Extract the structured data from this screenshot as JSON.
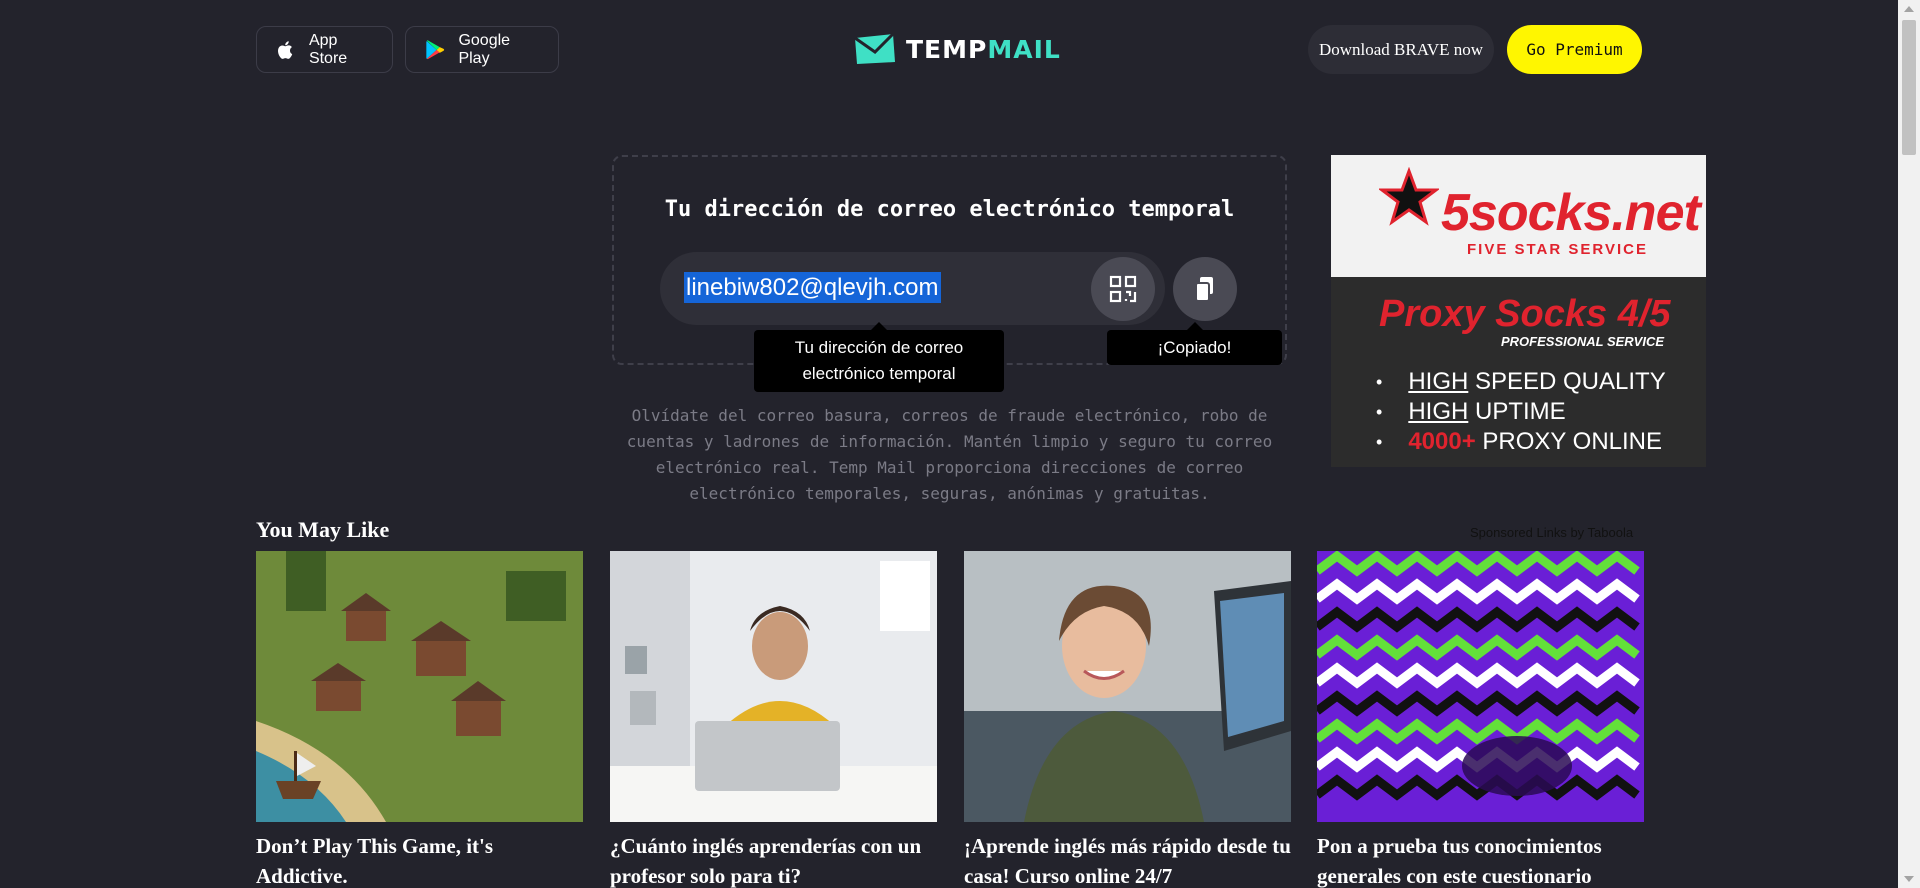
{
  "header": {
    "app_store_label": "App Store",
    "google_play_label": "Google Play",
    "logo_text_a": "TEMP",
    "logo_text_b": "MAIL",
    "brave_label": "Download BRAVE now",
    "premium_label": "Go Premium"
  },
  "email_box": {
    "title": "Tu dirección de correo electrónico temporal",
    "email": "linebiw802@qlevjh.com",
    "tooltip_email": "Tu dirección de correo electrónico temporal",
    "tooltip_copy": "¡Copiado!"
  },
  "description": "Olvídate del correo basura, correos de fraude electrónico, robo de cuentas y ladrones de información. Mantén limpio y seguro tu correo electrónico real. Temp Mail proporciona direcciones de correo electrónico temporales, seguras, anónimas y gratuitas.",
  "ad": {
    "logo_text": "5socks.net",
    "logo_tagline": "FIVE STAR SERVICE",
    "headline": "Proxy Socks 4/5",
    "subheadline": "PROFESSIONAL SERVICE",
    "items": [
      {
        "a": "HIGH",
        "b": " SPEED QUALITY"
      },
      {
        "a": "HIGH",
        "b": " UPTIME"
      },
      {
        "a": "4000+",
        "b": " PROXY ONLINE"
      }
    ]
  },
  "recommendations": {
    "title": "You May Like",
    "sponsored": "Sponsored Links by Taboola",
    "cards": [
      {
        "title": "Don’t Play This Game, it's Addictive."
      },
      {
        "title": "¿Cuánto inglés aprenderías con un profesor solo para ti?"
      },
      {
        "title": "¡Aprende inglés más rápido desde tu casa! Curso online 24/7"
      },
      {
        "title": "Pon a prueba tus conocimientos generales con este cuestionario"
      }
    ]
  },
  "colors": {
    "background": "#23232c",
    "accent_teal": "#3fe0c5",
    "premium_yellow": "#fff600",
    "selection_blue": "#1565d8",
    "ad_red": "#e0232e"
  }
}
